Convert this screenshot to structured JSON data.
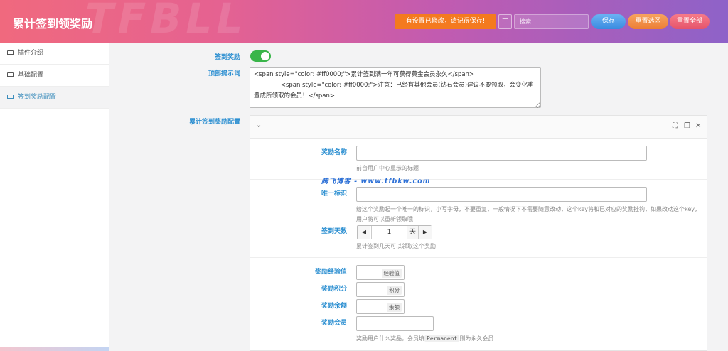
{
  "header": {
    "title": "累计签到领奖励",
    "watermark": "TFBLL",
    "notice": "有设置已修改，请记得保存!",
    "search_placeholder": "搜索...",
    "save_label": "保存",
    "reset_selection_label": "重置选区",
    "reset_all_label": "重置全部"
  },
  "sidebar": {
    "items": [
      {
        "label": "插件介绍"
      },
      {
        "label": "基础配置"
      },
      {
        "label": "签到奖励配置"
      }
    ]
  },
  "form": {
    "signin_reward_label": "签到奖励",
    "top_tip_label": "顶部提示词",
    "top_tip_value": "<span style=\"color: #ff0000;\">累计签到满一年可获得黄金会员永久</span>\n              <span style=\"color: #ff0000;\">注意：已经有其他会员(钻石会员)建议不要领取，会变化重置成所领取的会员！</span>",
    "reward_config_label": "累计签到奖励配置"
  },
  "panel": {
    "name_label": "奖励名称",
    "name_value": "",
    "name_help": "前台用户中心显示的标题",
    "id_label": "唯一标识",
    "id_value": "",
    "id_help": "给这个奖励起一个唯一的标识，小写字母，不要重复，一般情况下不需要随意改动，这个key将和已对应的奖励挂钩，如果改动这个key，用户将可以重新领取哦",
    "days_label": "签到天数",
    "days_value": "1",
    "days_unit": "天",
    "days_help": "累计签到几天可以领取这个奖励",
    "exp_label": "奖励经验值",
    "exp_addon": "经验值",
    "points_label": "奖励积分",
    "points_addon": "积分",
    "balance_label": "奖励余额",
    "balance_addon": "余额",
    "vip_label": "奖励会员",
    "vip_help_before": "奖励用户什么奖品，会员填",
    "vip_help_code": "Permanent",
    "vip_help_after": "则为永久会员"
  },
  "overlay": {
    "watermark_text": "腾飞博客 - www.tfbkw.com"
  },
  "colors": {
    "accent_blue": "#2c8fd1",
    "toggle_on": "#3ab54a",
    "notice_orange": "#f47a1f"
  }
}
